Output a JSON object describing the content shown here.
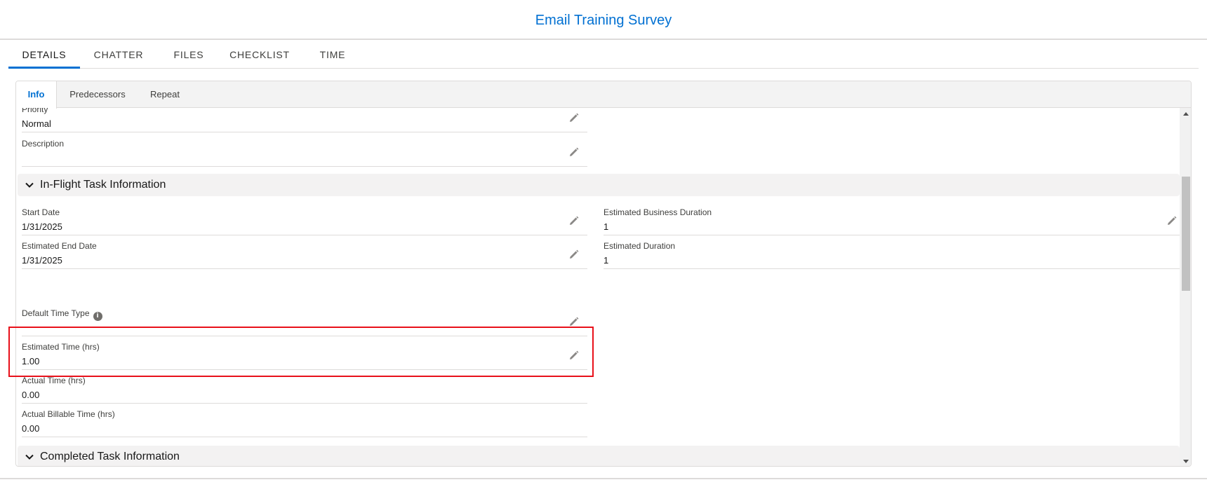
{
  "header": {
    "title": "Email Training Survey"
  },
  "tabs": [
    {
      "label": "DETAILS",
      "active": true
    },
    {
      "label": "CHATTER",
      "active": false
    },
    {
      "label": "FILES",
      "active": false
    },
    {
      "label": "CHECKLIST",
      "active": false
    },
    {
      "label": "TIME",
      "active": false
    }
  ],
  "subtabs": [
    {
      "label": "Info",
      "active": true
    },
    {
      "label": "Predecessors",
      "active": false
    },
    {
      "label": "Repeat",
      "active": false
    }
  ],
  "fields": {
    "priority": {
      "label": "Priority",
      "value": "Normal"
    },
    "description": {
      "label": "Description",
      "value": ""
    },
    "start_date": {
      "label": "Start Date",
      "value": "1/31/2025"
    },
    "estimated_business_duration": {
      "label": "Estimated Business Duration",
      "value": "1"
    },
    "estimated_end_date": {
      "label": "Estimated End Date",
      "value": "1/31/2025"
    },
    "estimated_duration": {
      "label": "Estimated Duration",
      "value": "1"
    },
    "default_time_type": {
      "label": "Default Time Type",
      "value": ""
    },
    "estimated_time": {
      "label": "Estimated Time (hrs)",
      "value": "1.00"
    },
    "actual_time": {
      "label": "Actual Time (hrs)",
      "value": "0.00"
    },
    "actual_billable_time": {
      "label": "Actual Billable Time (hrs)",
      "value": "0.00"
    }
  },
  "sections": {
    "in_flight": {
      "title": "In-Flight Task Information"
    },
    "completed": {
      "title": "Completed Task Information"
    }
  },
  "icons": {
    "info": "i",
    "edit": "pencil-icon",
    "chevron": "chevron-down-icon"
  },
  "colors": {
    "accent": "#0070d2",
    "highlight": "#e8101a",
    "section_bg": "#f3f2f2"
  }
}
